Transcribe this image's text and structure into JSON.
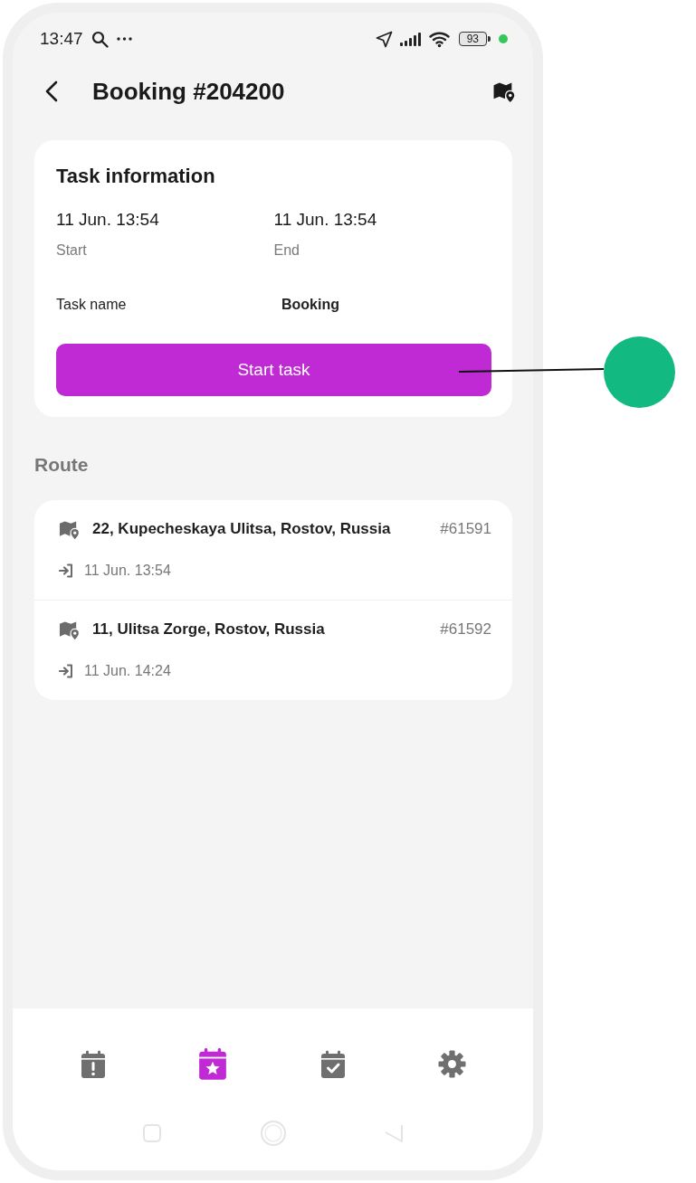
{
  "status_bar": {
    "time": "13:47",
    "battery": "93"
  },
  "header": {
    "title": "Booking #204200"
  },
  "task_card": {
    "title": "Task information",
    "start": {
      "value": "11 Jun. 13:54",
      "label": "Start"
    },
    "end": {
      "value": "11 Jun. 13:54",
      "label": "End"
    },
    "name_label": "Task name",
    "name_value": "Booking",
    "button": "Start task"
  },
  "route": {
    "heading": "Route",
    "stops": [
      {
        "address": "22, Kupecheskaya Ulitsa, Rostov, Russia",
        "number": "#61591",
        "time": "11 Jun. 13:54"
      },
      {
        "address": "11, Ulitsa Zorge, Rostov, Russia",
        "number": "#61592",
        "time": "11 Jun. 14:24"
      }
    ]
  },
  "bottom_nav": [
    {
      "kind": "calendar-alert",
      "selected": false
    },
    {
      "kind": "calendar-star",
      "selected": true
    },
    {
      "kind": "calendar-check",
      "selected": false
    },
    {
      "kind": "settings",
      "selected": false
    }
  ],
  "system_nav": [
    {
      "kind": "recents"
    },
    {
      "kind": "home"
    },
    {
      "kind": "back"
    }
  ],
  "callout": {
    "kind": "dot"
  }
}
